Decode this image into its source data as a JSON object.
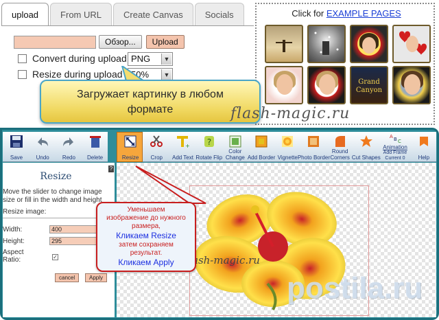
{
  "top": {
    "tabs": [
      {
        "label": "upload",
        "active": true
      },
      {
        "label": "From URL",
        "active": false
      },
      {
        "label": "Create Canvas",
        "active": false
      },
      {
        "label": "Socials",
        "active": false
      }
    ],
    "browse_button": "Обзор...",
    "upload_button": "Upload",
    "convert_label": "Convert during upload",
    "convert_format": "PNG",
    "resize_label": "Resize during upload",
    "resize_value": "50%",
    "examples": {
      "prefix": "Click for ",
      "link": "EXAMPLE PAGES"
    },
    "callout": {
      "line1": "Загружает картинку в любом",
      "line2": "формате"
    },
    "watermark": "flash-magic.ru"
  },
  "toolbar": {
    "tools": [
      "Save",
      "Undo",
      "Redo",
      "Delete",
      "Resize",
      "Crop",
      "Add Text",
      "Rotate Flip",
      "Color Change",
      "Add Border",
      "Vignette",
      "Photo Border",
      "Round Corners",
      "Cut Shapes",
      "Animation",
      "Help"
    ],
    "animation_sub1": "Add Frame",
    "animation_sub2": "Current 0",
    "selected": "Resize"
  },
  "resize_panel": {
    "title": "Resize",
    "help": "?",
    "description": "Move the slider to change image size or fill in the width and height",
    "resize_image_label": "Resize image:",
    "width_label": "Width:",
    "width_value": "400",
    "height_label": "Height:",
    "height_value": "295",
    "aspect_label": "Aspect Ratio:",
    "aspect_checked": "✓",
    "cancel_button": "cancel",
    "apply_button": "Apply"
  },
  "callout2": {
    "l1": "Уменьшаем",
    "l2": "изображение до нужного",
    "l3": "размера,",
    "l4": "Кликаем Resize",
    "l5": "затем сохраняем",
    "l6": "результат.",
    "l7": "Кликаем Apply"
  },
  "canvas": {
    "watermark": "flash-magic.ru",
    "watermark_big": "postila.ru"
  },
  "colors": {
    "frame": "#2e8d9a",
    "accent_blue": "#1a3fd6",
    "callout_red": "#c81e1e",
    "selected_tool": "#f6a63c"
  }
}
